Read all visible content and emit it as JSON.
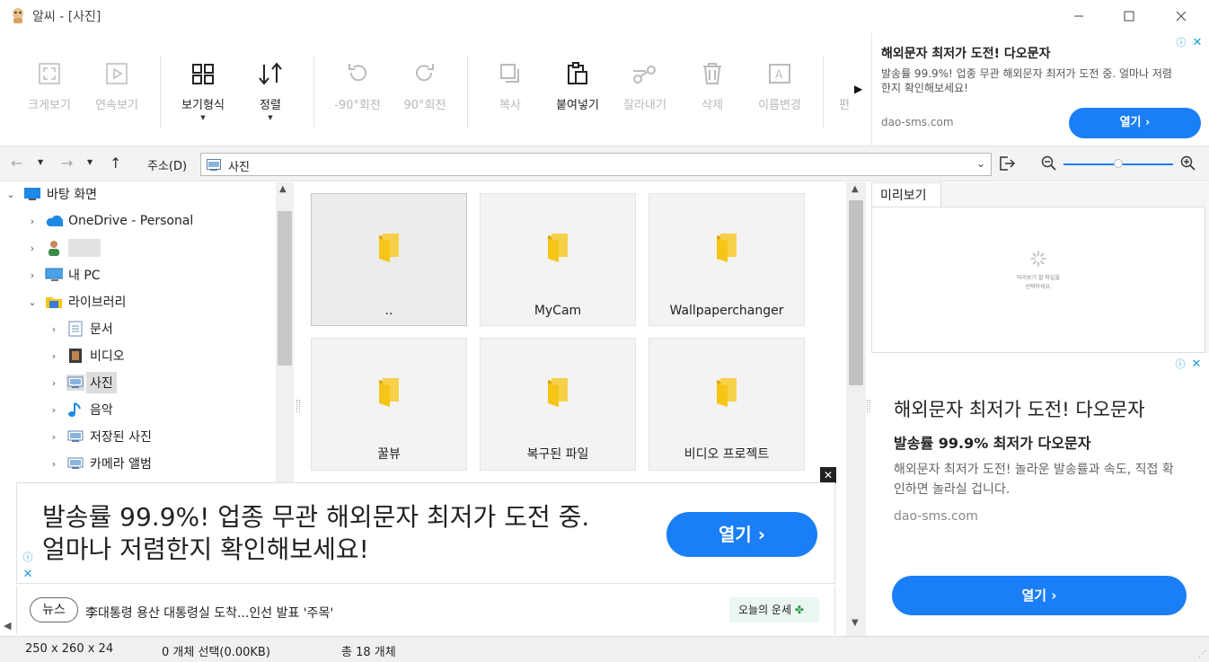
{
  "window": {
    "title": "알씨 - [사진]"
  },
  "toolbar": {
    "items": [
      {
        "label": "크게보기",
        "icon": "fullscreen-icon",
        "enabled": false
      },
      {
        "label": "연속보기",
        "icon": "play-icon",
        "enabled": false
      },
      {
        "label": "보기형식",
        "icon": "grid-view-icon",
        "enabled": true
      },
      {
        "label": "정렬",
        "icon": "sort-icon",
        "enabled": true
      },
      {
        "label": "-90°회전",
        "icon": "rotate-left-icon",
        "enabled": false
      },
      {
        "label": "90°회전",
        "icon": "rotate-right-icon",
        "enabled": false
      },
      {
        "label": "복사",
        "icon": "copy-icon",
        "enabled": false
      },
      {
        "label": "붙여넣기",
        "icon": "paste-icon",
        "enabled": true
      },
      {
        "label": "잘라내기",
        "icon": "cut-icon",
        "enabled": false
      },
      {
        "label": "삭제",
        "icon": "trash-icon",
        "enabled": false
      },
      {
        "label": "이름변경",
        "icon": "rename-icon",
        "enabled": false
      },
      {
        "label": "편",
        "icon": "edit-icon",
        "enabled": false
      }
    ],
    "more": "▶"
  },
  "ad_top": {
    "title": "해외문자 최저가 도전! 다오문자",
    "desc": "발송률 99.9%! 업종 무관 해외문자 최저가 도전 중. 얼마나 저렴한지 확인해보세요!",
    "domain": "dao-sms.com",
    "button": "열기 ›"
  },
  "address": {
    "label": "주소(D)",
    "value": "사진"
  },
  "tree": {
    "items": [
      {
        "label": "바탕 화면",
        "icon": "desktop-icon",
        "level": 0,
        "expanded": true
      },
      {
        "label": "OneDrive - Personal",
        "icon": "cloud-icon",
        "level": 1,
        "expanded": false
      },
      {
        "label": "",
        "icon": "user-icon",
        "level": 1,
        "expanded": false
      },
      {
        "label": "내 PC",
        "icon": "computer-icon",
        "level": 1,
        "expanded": false
      },
      {
        "label": "라이브러리",
        "icon": "library-icon",
        "level": 1,
        "expanded": true
      },
      {
        "label": "문서",
        "icon": "document-icon",
        "level": 2,
        "expanded": false
      },
      {
        "label": "비디오",
        "icon": "video-icon",
        "level": 2,
        "expanded": false
      },
      {
        "label": "사진",
        "icon": "picture-icon",
        "level": 2,
        "expanded": false,
        "selected": true
      },
      {
        "label": "음악",
        "icon": "music-icon",
        "level": 2,
        "expanded": false
      },
      {
        "label": "저장된 사진",
        "icon": "picture-icon",
        "level": 2,
        "expanded": false
      },
      {
        "label": "카메라 앨범",
        "icon": "picture-icon",
        "level": 2,
        "expanded": false
      }
    ]
  },
  "files": [
    {
      "name": "..",
      "selected": true
    },
    {
      "name": "MyCam",
      "selected": false
    },
    {
      "name": "Wallpaperchanger",
      "selected": false
    },
    {
      "name": "꿀뷰",
      "selected": false
    },
    {
      "name": "복구된 파일",
      "selected": false
    },
    {
      "name": "비디오 프로젝트",
      "selected": false
    }
  ],
  "ad_bottom": {
    "text": "발송률 99.9%! 업종 무관 해외문자 최저가 도전 중. 얼마나 저렴한지 확인해보세요!",
    "button": "열기 ›"
  },
  "news": {
    "badge": "뉴스",
    "headline": "李대통령 용산 대통령실 도착...인선 발표 '주목'",
    "fortune": "오늘의 운세"
  },
  "preview": {
    "tab": "미리보기",
    "hint_line1": "미리보기 할 파일을",
    "hint_line2": "선택하세요."
  },
  "ad_right": {
    "title": "해외문자 최저가 도전! 다오문자",
    "sub": "발송률 99.9% 최저가 다오문자",
    "desc": "해외문자 최저가 도전! 놀라운 발송률과 속도, 직접 확인하면 놀라실 겁니다.",
    "domain": "dao-sms.com",
    "button": "열기 ›"
  },
  "status": {
    "size": "250 x 260 x 24",
    "selection": "0 개체 선택(0.00KB)",
    "total": "총 18 개체"
  },
  "colors": {
    "accent": "#1a7ef6",
    "folder": "#f5c518"
  }
}
